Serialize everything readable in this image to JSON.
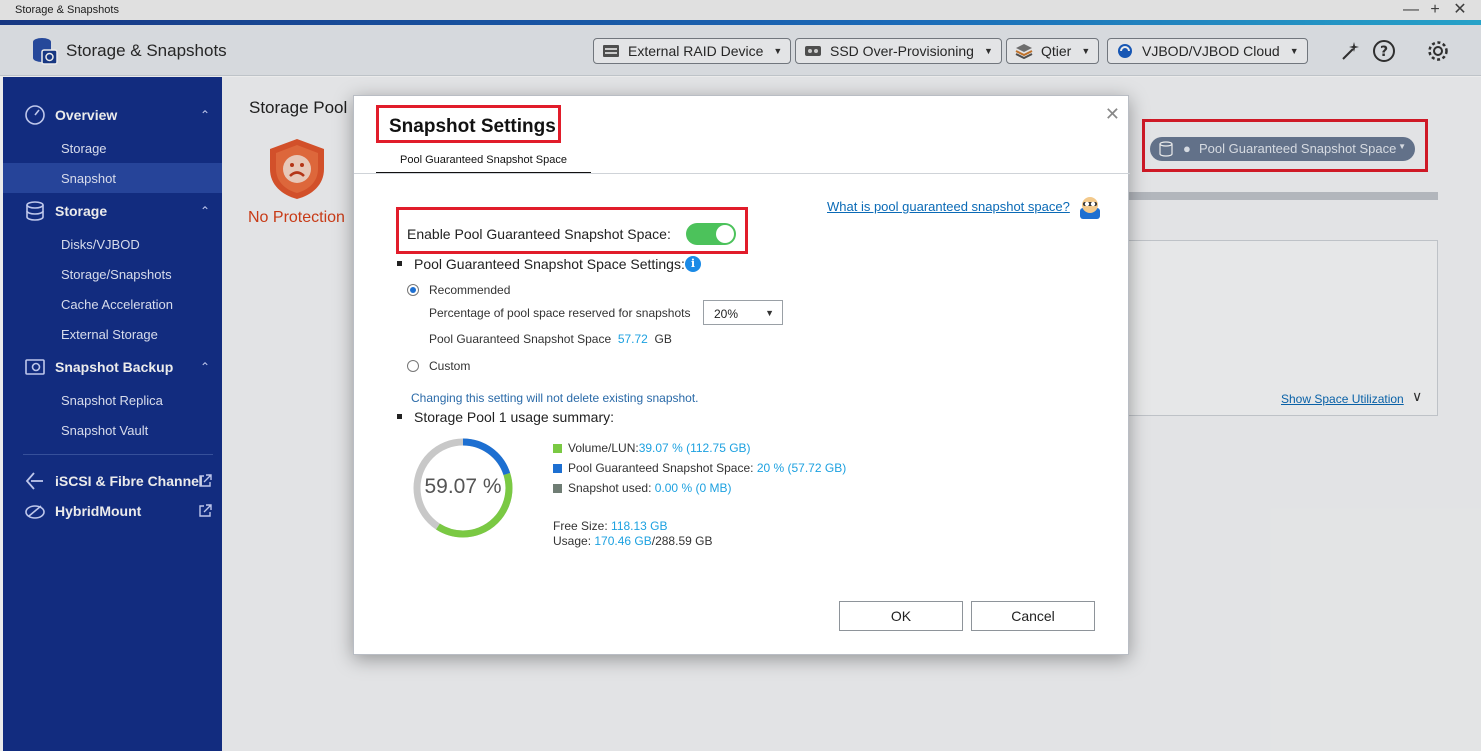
{
  "window": {
    "title": "Storage & Snapshots"
  },
  "header": {
    "app_title": "Storage & Snapshots",
    "buttons": [
      {
        "label": "External RAID Device"
      },
      {
        "label": "SSD Over-Provisioning"
      },
      {
        "label": "Qtier"
      },
      {
        "label": "VJBOD/VJBOD Cloud"
      }
    ]
  },
  "sidebar": {
    "groups": [
      {
        "label": "Overview",
        "items": [
          "Storage",
          "Snapshot"
        ]
      },
      {
        "label": "Storage",
        "items": [
          "Disks/VJBOD",
          "Storage/Snapshots",
          "Cache Acceleration",
          "External Storage"
        ]
      },
      {
        "label": "Snapshot Backup",
        "items": [
          "Snapshot Replica",
          "Snapshot Vault"
        ]
      }
    ],
    "links": [
      {
        "label": "iSCSI & Fibre Channel"
      },
      {
        "label": "HybridMount"
      }
    ],
    "active_item": "Snapshot"
  },
  "main": {
    "page_title": "Storage Pool",
    "protection_status": "No Protection",
    "pool_dropdown": "Pool Guaranteed Snapshot Space",
    "show_space_link": "Show Space Utilization"
  },
  "dialog": {
    "title": "Snapshot Settings",
    "tab": "Pool Guaranteed Snapshot Space",
    "help_link": "What is pool guaranteed snapshot space?",
    "enable_label": "Enable Pool Guaranteed Snapshot Space:",
    "enabled": true,
    "settings_label": "Pool Guaranteed Snapshot Space Settings:",
    "recommended_label": "Recommended",
    "percentage_label": "Percentage of pool space reserved for snapshots",
    "percentage_value": "20%",
    "space_label": "Pool Guaranteed Snapshot Space",
    "space_value": "57.72",
    "space_unit": "GB",
    "custom_label": "Custom",
    "note": "Changing this setting will not delete existing snapshot.",
    "summary_label": "Storage Pool 1 usage summary:",
    "usage_percent": "59.07 %",
    "usage_fraction": 0.5907,
    "legend": [
      {
        "label": "Volume/LUN:",
        "value": "39.07 % (112.75 GB)",
        "color": "#7ac943"
      },
      {
        "label": "Pool Guaranteed Snapshot Space:",
        "value": "20 % (57.72 GB)",
        "color": "#1d6fd1"
      },
      {
        "label": "Snapshot used:",
        "value": "0.00 % (0 MB)",
        "color": "#6f7d74"
      }
    ],
    "free_size_label": "Free Size:",
    "free_size_value": "118.13 GB",
    "usage_label": "Usage:",
    "usage_value": "170.46 GB",
    "usage_total": "/288.59 GB",
    "ok_label": "OK",
    "cancel_label": "Cancel"
  },
  "colors": {
    "accent": "#e11c2a",
    "toggle_on": "#4cc25b",
    "link": "#0a6ab6"
  }
}
